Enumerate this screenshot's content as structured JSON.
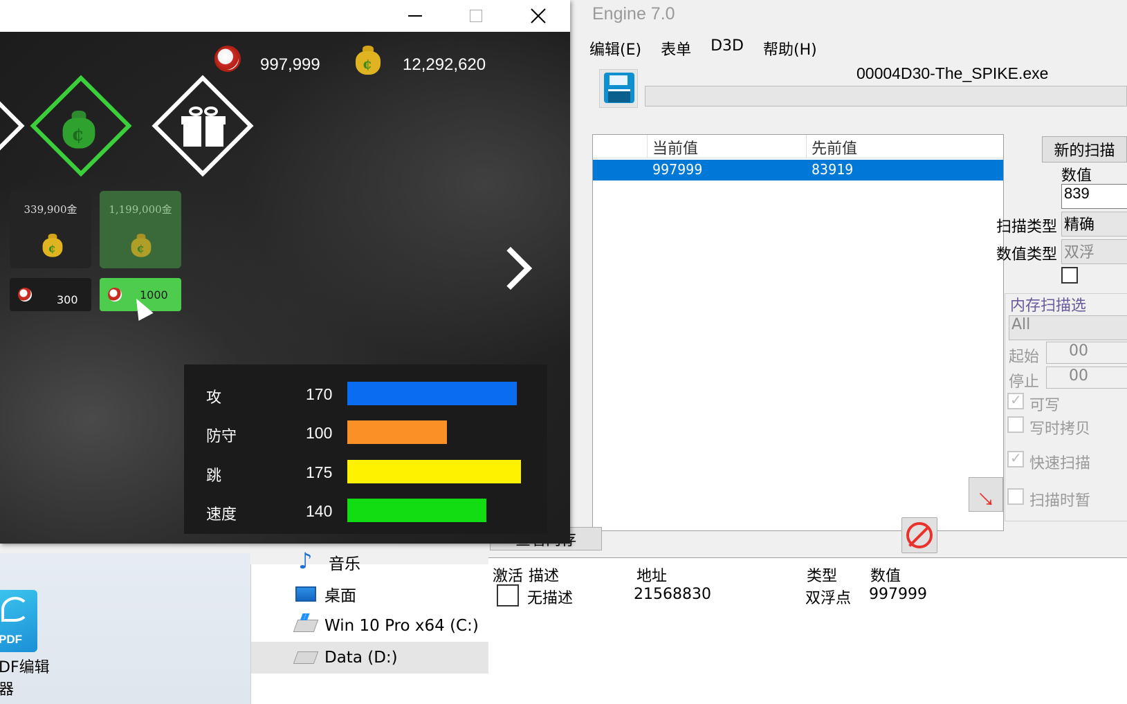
{
  "desktop": {
    "pdf_icon_text": "PDF",
    "pdf_label": "DF编辑\n器"
  },
  "explorer": {
    "items": [
      {
        "label": "音乐",
        "icon": "music-icon"
      },
      {
        "label": "桌面",
        "icon": "desktop-icon"
      },
      {
        "label": "Win 10 Pro x64 (C:)",
        "icon": "drive-icon"
      },
      {
        "label": "Data (D:)",
        "icon": "drive-icon",
        "selected": true
      }
    ]
  },
  "ce": {
    "title": "Engine 7.0",
    "menu": [
      "编辑(E)",
      "表单",
      "D3D",
      "帮助(H)"
    ],
    "process": "00004D30-The_SPIKE.exe",
    "results": {
      "columns": [
        "当前值",
        "先前值"
      ],
      "rows": [
        {
          "current": "997999",
          "previous": "83919"
        }
      ]
    },
    "new_scan": "新的扫描",
    "value_label": "数值",
    "value_input": "839",
    "scan_type_label": "扫描类型",
    "scan_type_value": "精确",
    "value_type_label": "数值类型",
    "value_type_value": "双浮",
    "mem_options_label": "内存扫描选",
    "mem_region": "All",
    "start_label": "起始",
    "start_value": "00",
    "stop_label": "停止",
    "stop_value": "00",
    "writable_label": "可写",
    "copy_on_write_label": "写时拷贝",
    "fast_scan_label": "快速扫描",
    "pause_label": "扫描时暂",
    "view_memory": "查看内存",
    "address_list": {
      "columns": [
        "激活",
        "描述",
        "地址",
        "类型",
        "数值"
      ],
      "rows": [
        {
          "description": "无描述",
          "address": "21568830",
          "type": "双浮点",
          "value": "997999"
        }
      ]
    }
  },
  "game": {
    "balls_count": "997,999",
    "gold_count": "12,292,620",
    "shop": [
      {
        "price": "339,900金",
        "buy": "300"
      },
      {
        "price": "1,199,000金",
        "buy": "1000"
      }
    ],
    "stats": [
      {
        "label": "攻",
        "value": "170",
        "color": "#0a6cf0"
      },
      {
        "label": "防守",
        "value": "100",
        "color": "#fb9126"
      },
      {
        "label": "跳",
        "value": "175",
        "color": "#fff200"
      },
      {
        "label": "速度",
        "value": "140",
        "color": "#12dc12"
      }
    ]
  }
}
